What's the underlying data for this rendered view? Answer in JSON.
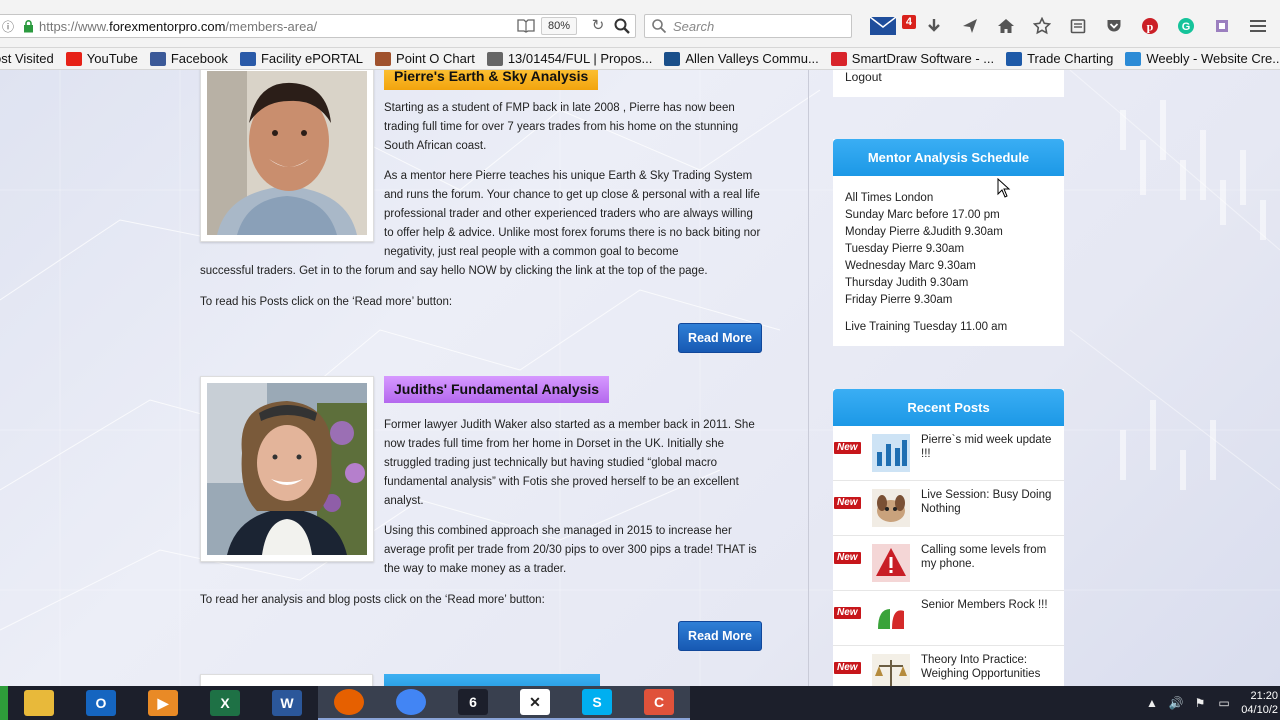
{
  "browser": {
    "url_prefix": "https://www.",
    "url_domain": "forexmentorpro.com",
    "url_path": "/members-area/",
    "zoom": "80%",
    "search_placeholder": "Search",
    "mail_count": "4"
  },
  "bookmarks": [
    {
      "label": "ost Visited",
      "icon": "star-icon",
      "color": "#f3f3f3"
    },
    {
      "label": "YouTube",
      "icon": "youtube-icon",
      "color": "#e62117"
    },
    {
      "label": "Facebook",
      "icon": "facebook-icon",
      "color": "#3b5998"
    },
    {
      "label": "Facility ePORTAL",
      "icon": "eportal-icon",
      "color": "#2a5aa8"
    },
    {
      "label": "Point O Chart",
      "icon": "pointo-icon",
      "color": "#a0522d"
    },
    {
      "label": "13/01454/FUL | Propos...",
      "icon": "planning-icon",
      "color": "#666666"
    },
    {
      "label": "Allen Valleys Commu...",
      "icon": "community-icon",
      "color": "#1a4f8a"
    },
    {
      "label": "SmartDraw Software - ...",
      "icon": "smartdraw-icon",
      "color": "#d8232a"
    },
    {
      "label": "Trade Charting",
      "icon": "tradecharting-icon",
      "color": "#1e5aa8"
    },
    {
      "label": "Weebly - Website Cre...",
      "icon": "weebly-icon",
      "color": "#2c8bd6"
    }
  ],
  "sidebar": {
    "logout": "Logout",
    "schedule_title": "Mentor Analysis Schedule",
    "schedule_lines": [
      "All Times London",
      "Sunday Marc before 17.00 pm",
      "Monday Pierre &Judith 9.30am",
      "Tuesday Pierre 9.30am",
      "Wednesday Marc 9.30am",
      "Thursday Judith 9.30am",
      "Friday Pierre 9.30am"
    ],
    "schedule_extra": "Live Training Tuesday 11.00 am",
    "recent_title": "Recent Posts",
    "new_badge": "New",
    "recent_posts": [
      "Pierre`s mid week update !!!",
      "Live Session: Busy Doing Nothing",
      "Calling some levels from my phone.",
      "Senior Members Rock !!!",
      "Theory Into Practice: Weighing Opportunities"
    ]
  },
  "pierre": {
    "title": "Pierre's Earth & Sky Analysis",
    "p1": "Starting as a student of FMP back in late 2008 , Pierre has now been trading full time for over 7 years  trades from his home on the stunning South African coast.",
    "p2a": "As a mentor here Pierre teaches his unique Earth & Sky Trading System and runs the forum. Your chance to get up close & personal with a real life professional trader and other experienced traders who are always willing to offer help & advice. Unlike most forex forums there is no back biting nor negativity, just real people with a common goal to become",
    "p2b": "successful traders. Get in to the forum and say hello NOW by clicking the link at the top of the page.",
    "p3": "To read his Posts click on the ‘Read more’ button:",
    "button": "Read More"
  },
  "judith": {
    "title": "Judiths' Fundamental Analysis",
    "p1": "Former lawyer Judith Waker also started as a member back in 2011. She now trades full time from her home in Dorset in the UK. Initially she struggled trading just technically but having studied “global macro fundamental analysis” with Fotis she proved herself to be an excellent analyst.",
    "p2": "Using this combined approach she managed in 2015 to increase her average profit per trade from 20/30 pips to over 300 pips a trade! THAT is the way to make money as a trader.",
    "p3": "To read her analysis and blog posts click on the ‘Read more’ button:",
    "button": "Read More"
  },
  "taskbar": {
    "apps": [
      {
        "name": "file-explorer-icon",
        "label": "",
        "color": "#e8b93a"
      },
      {
        "name": "outlook-icon",
        "label": "O",
        "color": "#1565c0"
      },
      {
        "name": "media-player-icon",
        "label": "▶",
        "color": "#e98a26"
      },
      {
        "name": "excel-icon",
        "label": "X",
        "color": "#1e7145"
      },
      {
        "name": "word-icon",
        "label": "W",
        "color": "#2b579a"
      },
      {
        "name": "firefox-icon",
        "label": "",
        "color": "#e66000"
      },
      {
        "name": "chrome-icon",
        "label": "",
        "color": "#4285f4"
      },
      {
        "name": "trading-app-icon",
        "label": "6",
        "color": "#1c1f2b"
      },
      {
        "name": "tools-app-icon",
        "label": "✕",
        "color": "#ffffff"
      },
      {
        "name": "skype-icon",
        "label": "S",
        "color": "#00aff0"
      },
      {
        "name": "camtasia-icon",
        "label": "C",
        "color": "#e0523a"
      }
    ],
    "time": "21:20",
    "date": "04/10/2"
  }
}
